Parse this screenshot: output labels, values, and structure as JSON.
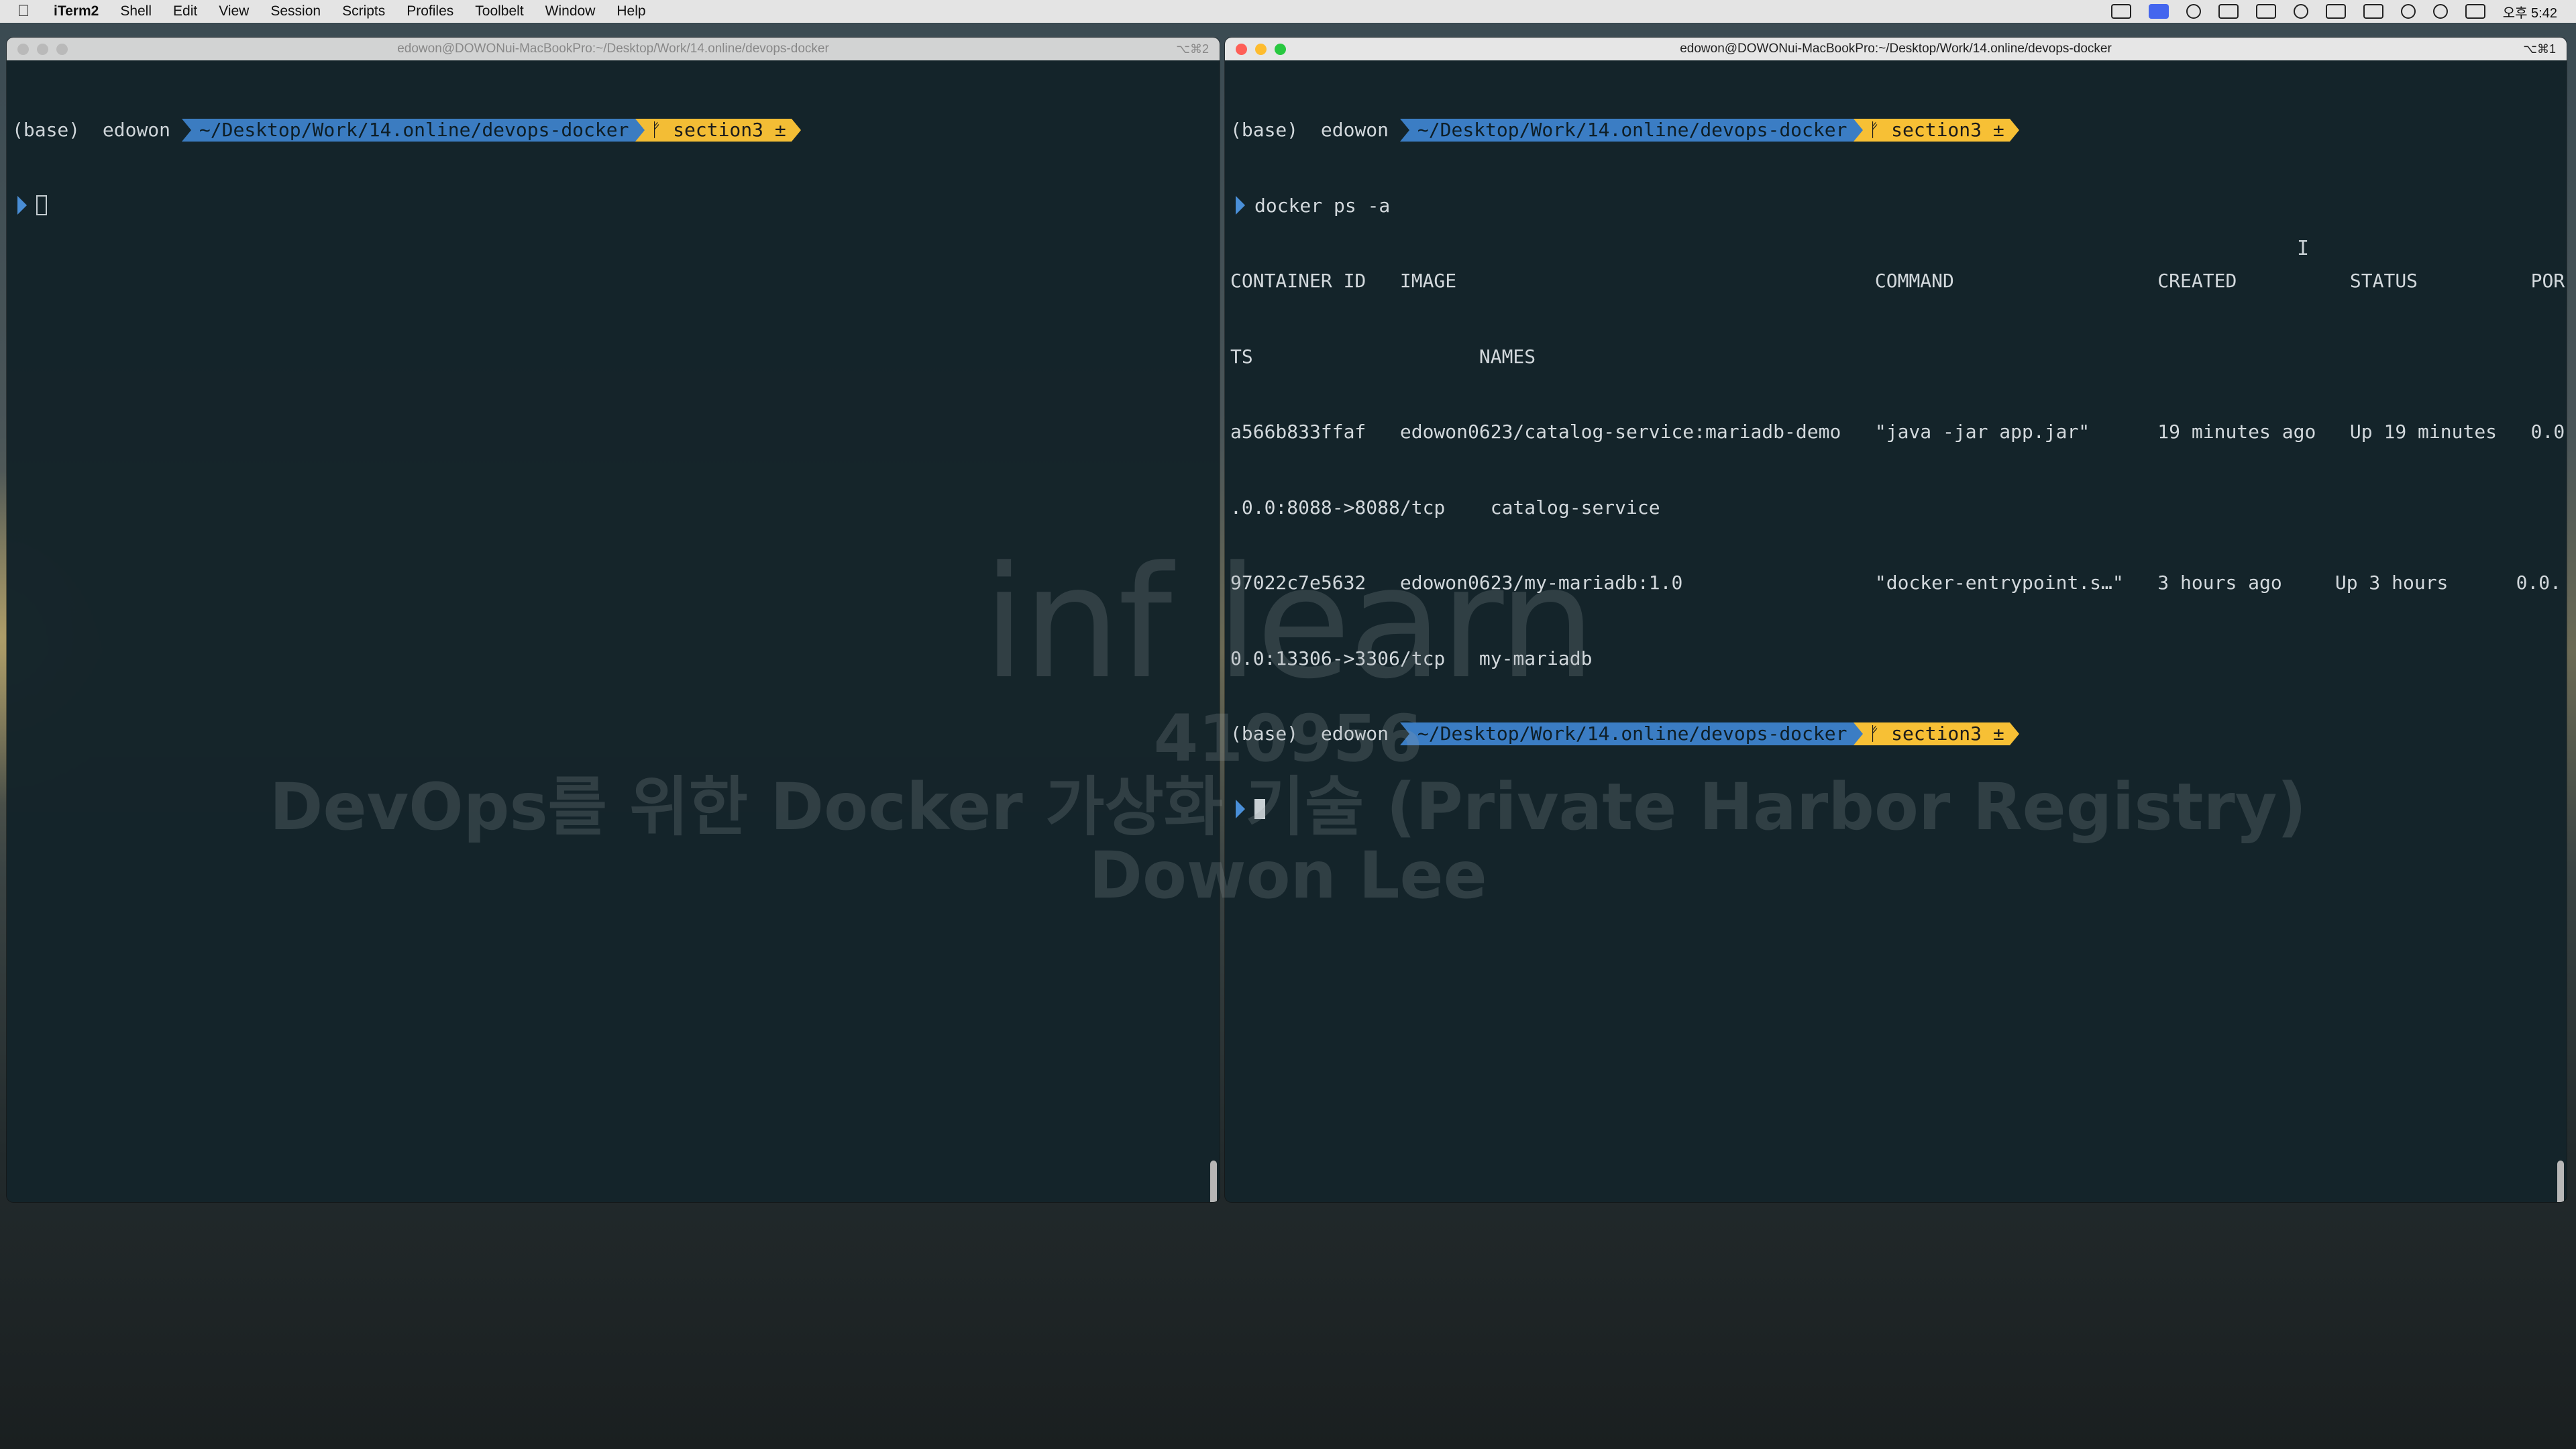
{
  "menubar": {
    "app": "iTerm2",
    "items": [
      "Shell",
      "Edit",
      "View",
      "Session",
      "Scripts",
      "Profiles",
      "Toolbelt",
      "Window",
      "Help"
    ],
    "clock": "오후 5:42"
  },
  "left_window": {
    "title": "edowon@DOWONui-MacBookPro:~/Desktop/Work/14.online/devops-docker",
    "shortcut": "⌥⌘2",
    "prompt": {
      "env": "(base)",
      "user": "edowon",
      "path": "~/Desktop/Work/14.online/devops-docker",
      "git": "ᚠ section3 ±"
    }
  },
  "right_window": {
    "title": "edowon@DOWONui-MacBookPro:~/Desktop/Work/14.online/devops-docker",
    "shortcut": "⌥⌘1",
    "prompt": {
      "env": "(base)",
      "user": "edowon",
      "path": "~/Desktop/Work/14.online/devops-docker",
      "git": "ᚠ section3 ±"
    },
    "command": "docker ps -a",
    "output": [
      "CONTAINER ID   IMAGE                                     COMMAND                  CREATED          STATUS          POR",
      "TS                    NAMES",
      "a566b833ffaf   edowon0623/catalog-service:mariadb-demo   \"java -jar app.jar\"      19 minutes ago   Up 19 minutes   0.0",
      ".0.0:8088->8088/tcp    catalog-service",
      "97022c7e5632   edowon0623/my-mariadb:1.0                 \"docker-entrypoint.s…\"   3 hours ago    ",
      "0.0:13306->3306/tcp   my-mariadb"
    ],
    "output_line5_tail": "Up 3 hours      0.0."
  },
  "watermark": {
    "logo": "inf learn",
    "id": "410956",
    "course": "DevOps를 위한 Docker 가상화 기술 (Private Harbor Registry)",
    "author": "Dowon Lee"
  }
}
